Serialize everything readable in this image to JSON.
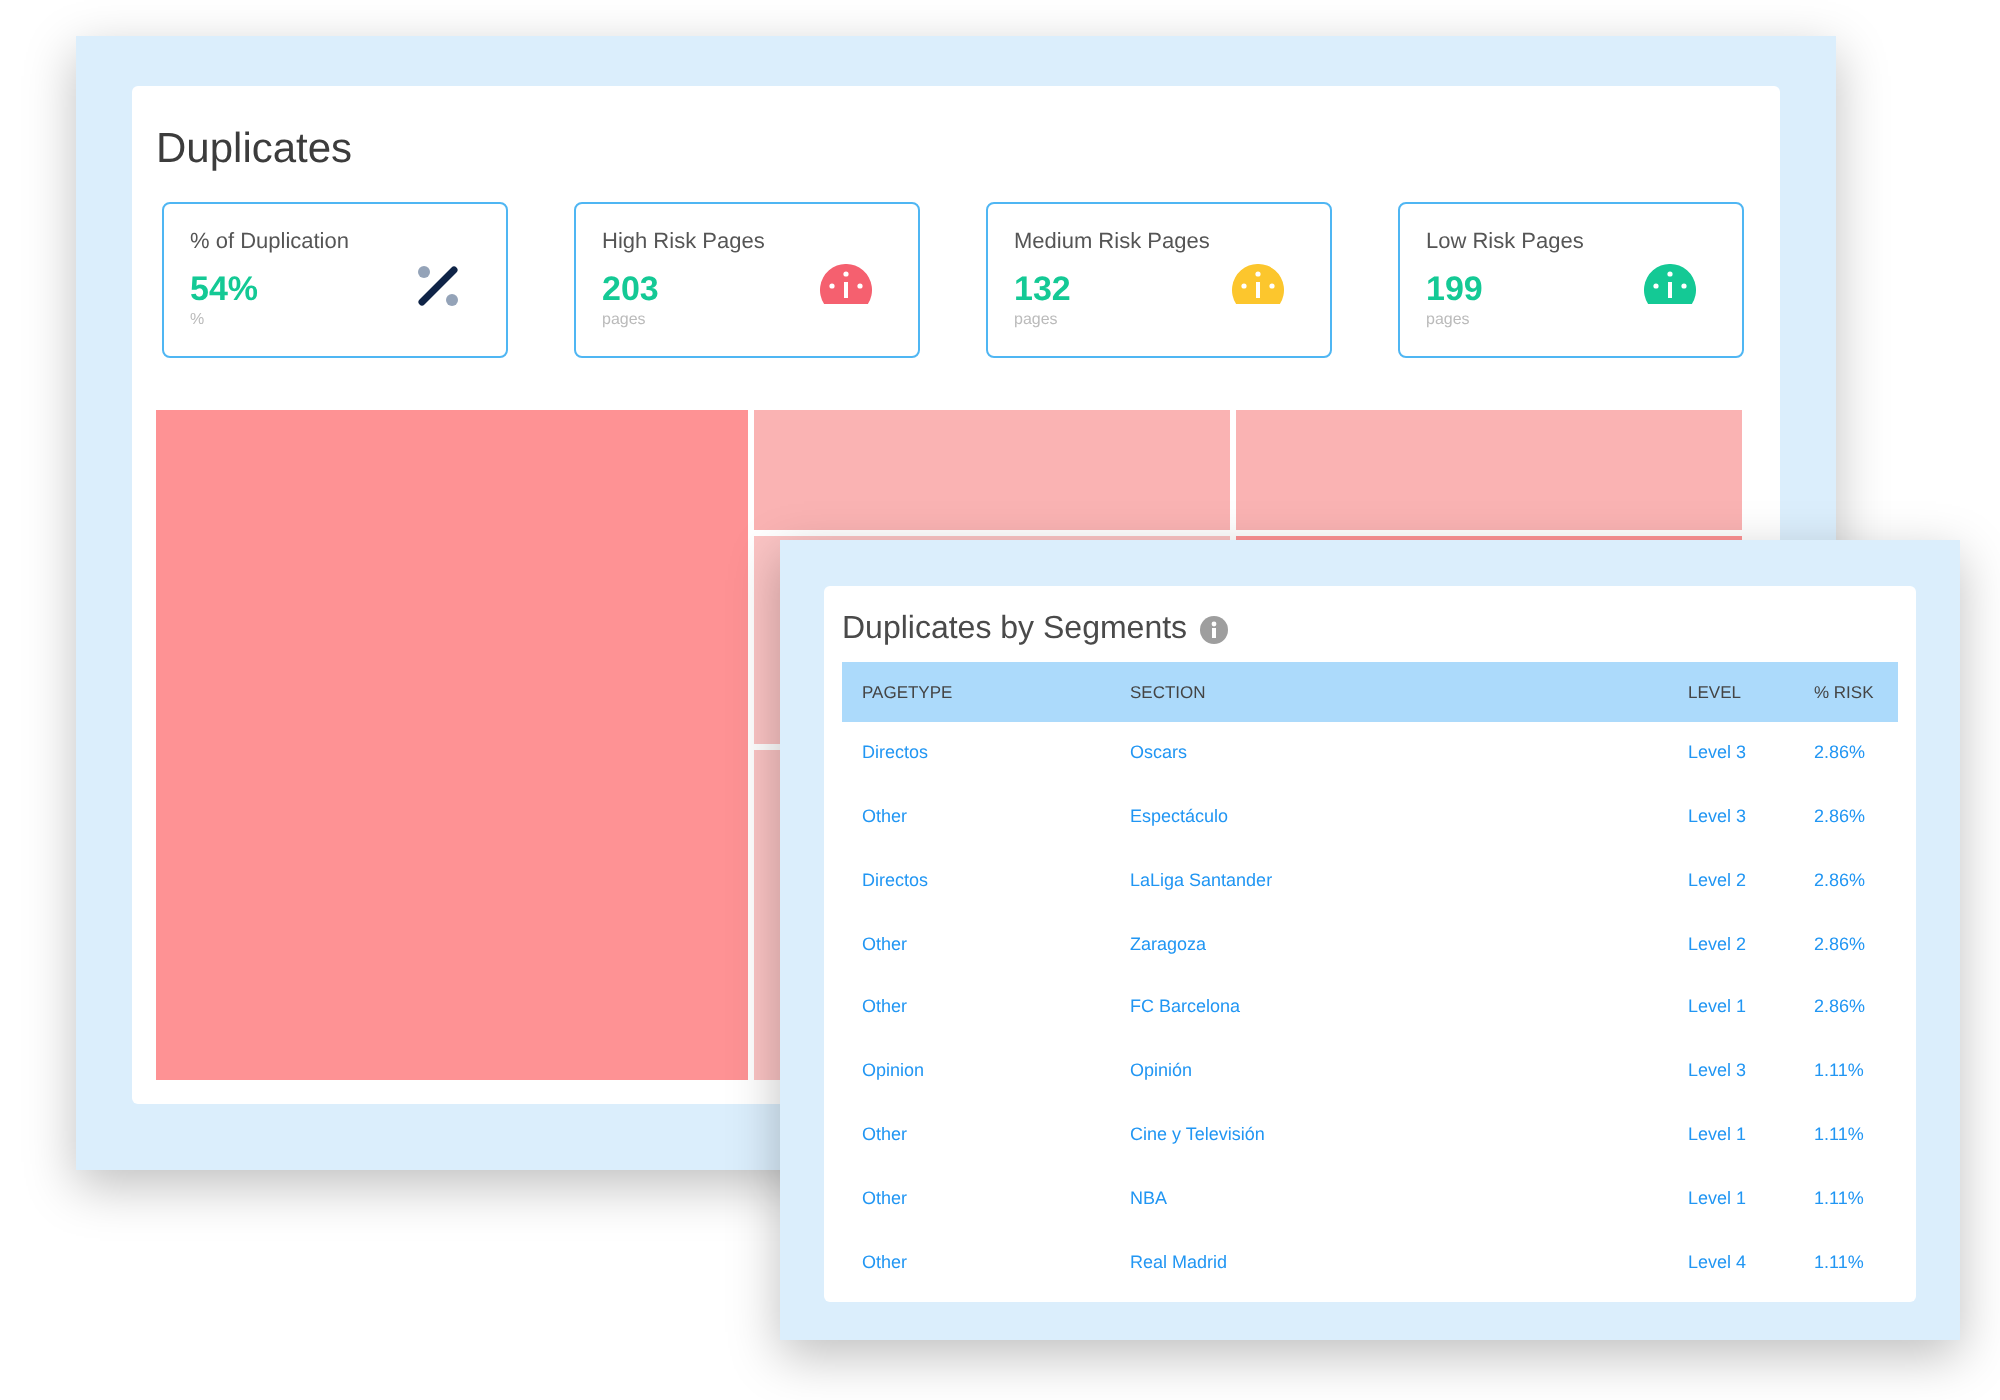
{
  "overview": {
    "title": "Duplicates",
    "cards": [
      {
        "label": "% of Duplication",
        "value": "54%",
        "unit": "%",
        "kind": "percent"
      },
      {
        "label": "High Risk Pages",
        "value": "203",
        "unit": "pages",
        "kind": "gauge",
        "color": "#f5606f"
      },
      {
        "label": "Medium Risk Pages",
        "value": "132",
        "unit": "pages",
        "kind": "gauge",
        "color": "#fcc62d"
      },
      {
        "label": "Low Risk Pages",
        "value": "199",
        "unit": "pages",
        "kind": "gauge",
        "color": "#14c995"
      }
    ]
  },
  "segments": {
    "title": "Duplicates by Segments",
    "columns": [
      "PAGETYPE",
      "SECTION",
      "LEVEL",
      "% RISK"
    ],
    "rows": [
      [
        "Directos",
        "Oscars",
        "Level 3",
        "2.86%"
      ],
      [
        "Other",
        "Espectáculo",
        "Level 3",
        "2.86%"
      ],
      [
        "Directos",
        "LaLiga Santander",
        "Level 2",
        "2.86%"
      ],
      [
        "Other",
        "Zaragoza",
        "Level 2",
        "2.86%"
      ],
      [
        "Other",
        "FC Barcelona",
        "Level 1",
        "2.86%"
      ],
      [
        "Opinion",
        "Opinión",
        "Level 3",
        "1.11%"
      ],
      [
        "Other",
        "Cine y Televisión",
        "Level 1",
        "1.11%"
      ],
      [
        "Other",
        "NBA",
        "Level 1",
        "1.11%"
      ],
      [
        "Other",
        "Real Madrid",
        "Level 4",
        "1.11%"
      ]
    ]
  }
}
